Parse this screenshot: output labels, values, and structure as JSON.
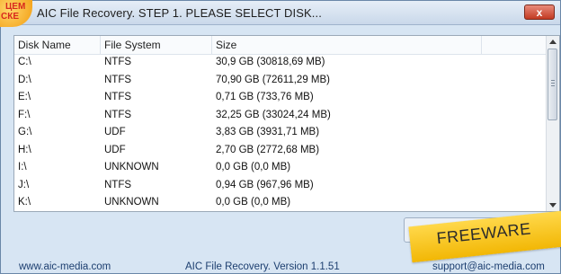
{
  "window": {
    "title": "AIC File Recovery. STEP 1. PLEASE SELECT DISK...",
    "close_label": "x"
  },
  "badge": {
    "line1": "ЦЕМ",
    "line2": "СКЕ"
  },
  "table": {
    "headers": [
      "Disk Name",
      "File System",
      "Size"
    ],
    "rows": [
      {
        "name": "C:\\",
        "fs": "NTFS",
        "size": "30,9 GB (30818,69 MB)"
      },
      {
        "name": "D:\\",
        "fs": "NTFS",
        "size": "70,90 GB (72611,29 MB)"
      },
      {
        "name": "E:\\",
        "fs": "NTFS",
        "size": "0,71 GB (733,76 MB)"
      },
      {
        "name": "F:\\",
        "fs": "NTFS",
        "size": "32,25 GB (33024,24 MB)"
      },
      {
        "name": "G:\\",
        "fs": "UDF",
        "size": "3,83 GB (3931,71 MB)"
      },
      {
        "name": "H:\\",
        "fs": "UDF",
        "size": "2,70 GB (2772,68 MB)"
      },
      {
        "name": "I:\\",
        "fs": "UNKNOWN",
        "size": "0,0 GB (0,0 MB)"
      },
      {
        "name": "J:\\",
        "fs": "NTFS",
        "size": "0,94 GB (967,96 MB)"
      },
      {
        "name": "K:\\",
        "fs": "UNKNOWN",
        "size": "0,0 GB (0,0 MB)"
      }
    ]
  },
  "footer": {
    "website": "www.aic-media.com",
    "version": "AIC File Recovery. Version 1.1.51",
    "email": "support@aic-media.com"
  },
  "ribbon": {
    "text": "FREEWARE"
  },
  "icons": {
    "close": "close-icon",
    "scroll_up": "arrow-up-icon",
    "scroll_down": "arrow-down-icon"
  }
}
